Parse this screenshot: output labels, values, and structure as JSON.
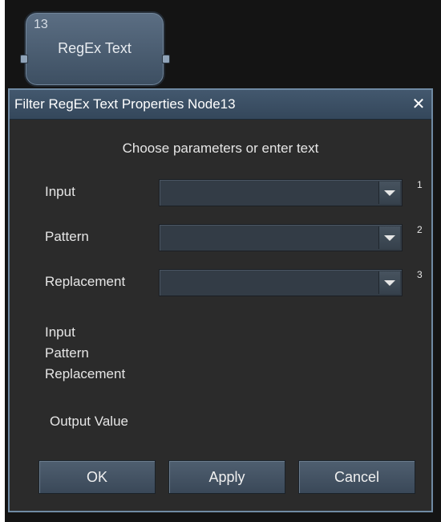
{
  "node": {
    "id": "13",
    "title": "RegEx Text"
  },
  "dialog": {
    "title": "Filter RegEx Text Properties Node13",
    "close_label": "✕",
    "instruction": "Choose parameters or enter text",
    "rows": [
      {
        "label": "Input",
        "value": "",
        "number": "1"
      },
      {
        "label": "Pattern",
        "value": "",
        "number": "2"
      },
      {
        "label": "Replacement",
        "value": "",
        "number": "3"
      }
    ],
    "info_lines": [
      "Input",
      "Pattern",
      "Replacement"
    ],
    "output_label": "Output Value",
    "buttons": {
      "ok": "OK",
      "apply": "Apply",
      "cancel": "Cancel"
    }
  },
  "colors": {
    "titlebar": "#3d5165",
    "background": "#2b2b2b",
    "node": "#4d6175",
    "text": "#e6e6e6"
  },
  "icons": {
    "close": "close-icon",
    "dropdown": "chevron-down-icon"
  }
}
